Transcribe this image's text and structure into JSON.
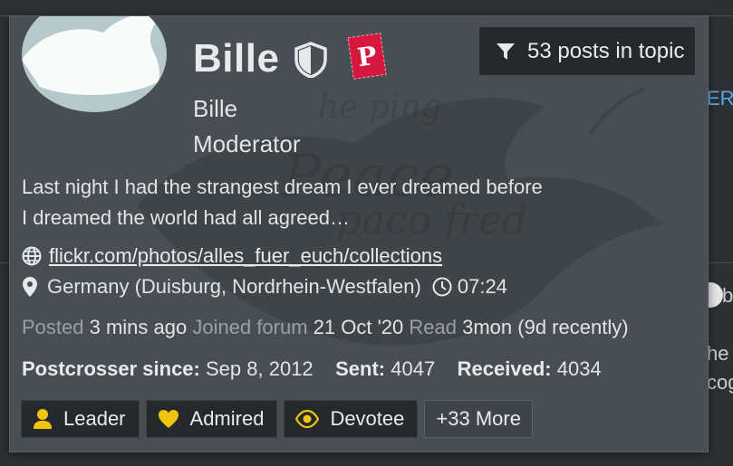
{
  "background": {
    "right_text_er": "ER",
    "right_text_b": "b",
    "right_text_he": "he",
    "right_text_cog": "cog"
  },
  "profile": {
    "username": "Bille",
    "subtitle": "Bille",
    "role": "Moderator",
    "signature_line1": "Last night I had the strangest dream I ever dreamed before",
    "signature_line2": "I dreamed the world had all agreed…",
    "website": "flickr.com/photos/alles_fuer_euch/collections",
    "location": "Germany (Duisburg, Nordrhein-Westfalen)",
    "local_time": "07:24",
    "badge_letter": "P"
  },
  "filter_button": {
    "label": "53 posts in topic"
  },
  "stats": {
    "posted_label": "Posted",
    "posted_value": "3 mins ago",
    "joined_label": "Joined forum",
    "joined_value": "21 Oct '20",
    "read_label": "Read",
    "read_value": "3mon (9d recently)"
  },
  "postcrosser": {
    "since_label": "Postcrosser since:",
    "since_value": "Sep 8, 2012",
    "sent_label": "Sent:",
    "sent_value": "4047",
    "received_label": "Received:",
    "received_value": "4034"
  },
  "badges": [
    {
      "label": "Leader",
      "icon": "user-icon"
    },
    {
      "label": "Admired",
      "icon": "heart-icon"
    },
    {
      "label": "Devotee",
      "icon": "eye-icon"
    },
    {
      "label": "+33 More"
    }
  ],
  "colors": {
    "card_bg": "#484e53",
    "dark_button": "#25292c",
    "badge_gold": "#f1c40f",
    "p_badge_red": "#d6183e",
    "link_blue": "#5aa9e6"
  }
}
